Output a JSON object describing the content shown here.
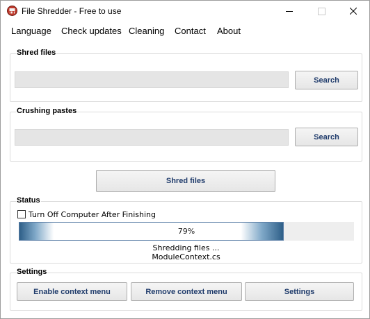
{
  "window": {
    "title": "File Shredder - Free to use",
    "app_icon": "shredder-app-icon"
  },
  "menu": {
    "items": [
      {
        "label": "Language"
      },
      {
        "label": "Check updates"
      },
      {
        "label": "Cleaning"
      },
      {
        "label": "Contact"
      },
      {
        "label": "About"
      }
    ]
  },
  "shred_files": {
    "title": "Shred files",
    "path_value": "",
    "search_label": "Search"
  },
  "crushing_pastes": {
    "title": "Crushing pastes",
    "path_value": "",
    "search_label": "Search"
  },
  "shred_button_label": "Shred files",
  "status": {
    "title": "Status",
    "turn_off_label": "Turn Off Computer After Finishing",
    "turn_off_checked": false,
    "progress_percent": 79,
    "progress_text": "79%",
    "message": "Shredding files ...",
    "current_file": "ModuleContext.cs"
  },
  "settings": {
    "title": "Settings",
    "enable_context_label": "Enable context menu",
    "remove_context_label": "Remove context menu",
    "settings_label": "Settings"
  },
  "colors": {
    "progress_dark": "#2e5f88",
    "button_text": "#1f3b6b",
    "app_icon_red": "#c0392b"
  }
}
